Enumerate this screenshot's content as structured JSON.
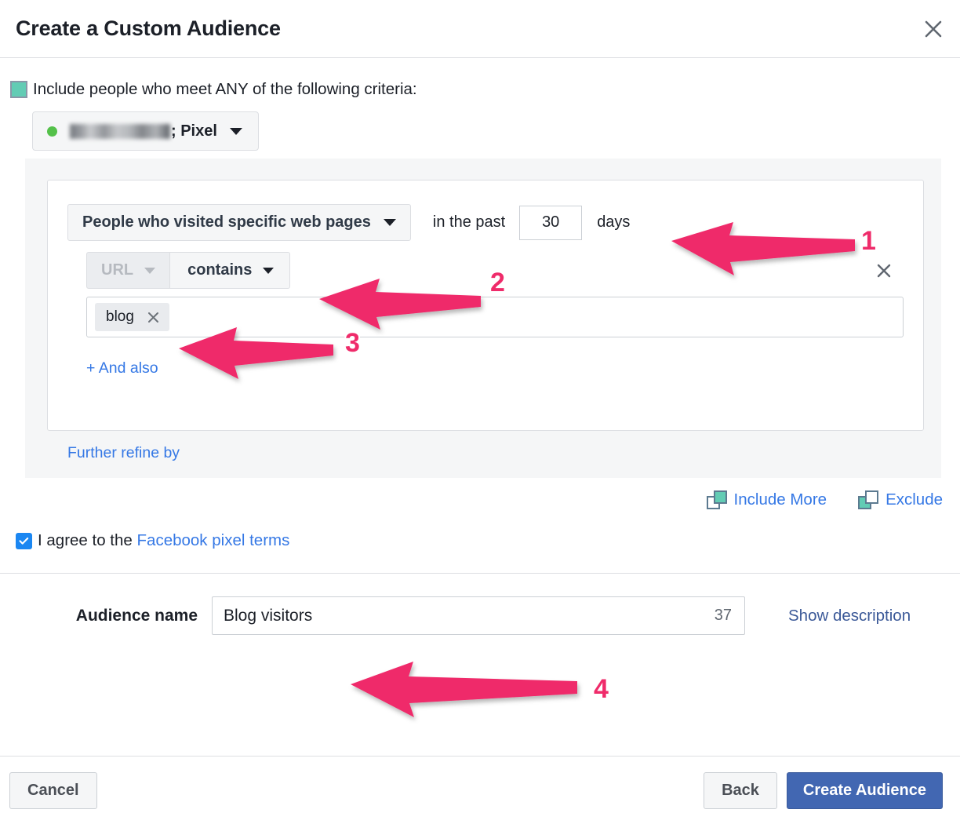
{
  "dialog": {
    "title": "Create a Custom Audience",
    "close_icon": "close-icon"
  },
  "include": {
    "checkbox_icon": "teal-filled-checkbox",
    "label": "Include people who meet ANY of the following criteria:",
    "pixel_selector": {
      "status_dot": "green-status-dot",
      "name_redacted": "",
      "suffix": "; Pixel",
      "caret_icon": "chevron-down-icon"
    }
  },
  "criteria": {
    "event_dropdown": {
      "label": "People who visited specific web pages",
      "caret_icon": "chevron-down-icon"
    },
    "retention": {
      "prefix": "in the past",
      "value": "30",
      "unit": "days"
    },
    "filter": {
      "field_label": "URL",
      "field_caret_icon": "chevron-down-icon",
      "operator_label": "contains",
      "operator_caret_icon": "chevron-down-icon",
      "remove_icon": "close-icon"
    },
    "values": [
      {
        "text": "blog",
        "remove_icon": "close-icon"
      }
    ],
    "add_rule_label": "+ And also",
    "further_refine_label": "Further refine by"
  },
  "audience_actions": {
    "include_more": {
      "label": "Include More",
      "icon": "overlapping-squares-include-icon"
    },
    "exclude": {
      "label": "Exclude",
      "icon": "overlapping-squares-exclude-icon"
    }
  },
  "terms": {
    "checkbox_icon": "blue-checked-checkbox",
    "checked": true,
    "text_before": "I agree to the ",
    "link_text": "Facebook pixel terms"
  },
  "audience_name": {
    "label": "Audience name",
    "value": "Blog visitors",
    "placeholder": "Audience name",
    "char_count": "37",
    "show_description_label": "Show description"
  },
  "footer": {
    "cancel_label": "Cancel",
    "back_label": "Back",
    "create_label": "Create Audience"
  },
  "annotations": {
    "color": "#ef2b6a",
    "markers": [
      {
        "number": "1"
      },
      {
        "number": "2"
      },
      {
        "number": "3"
      },
      {
        "number": "4"
      }
    ]
  },
  "colors": {
    "teal": "#62ccb4",
    "link_blue": "#3578e5",
    "primary_blue": "#4267b2",
    "checkbox_blue": "#1b87f2",
    "green_dot": "#54c14a",
    "annotation_pink": "#ef2b6a"
  }
}
